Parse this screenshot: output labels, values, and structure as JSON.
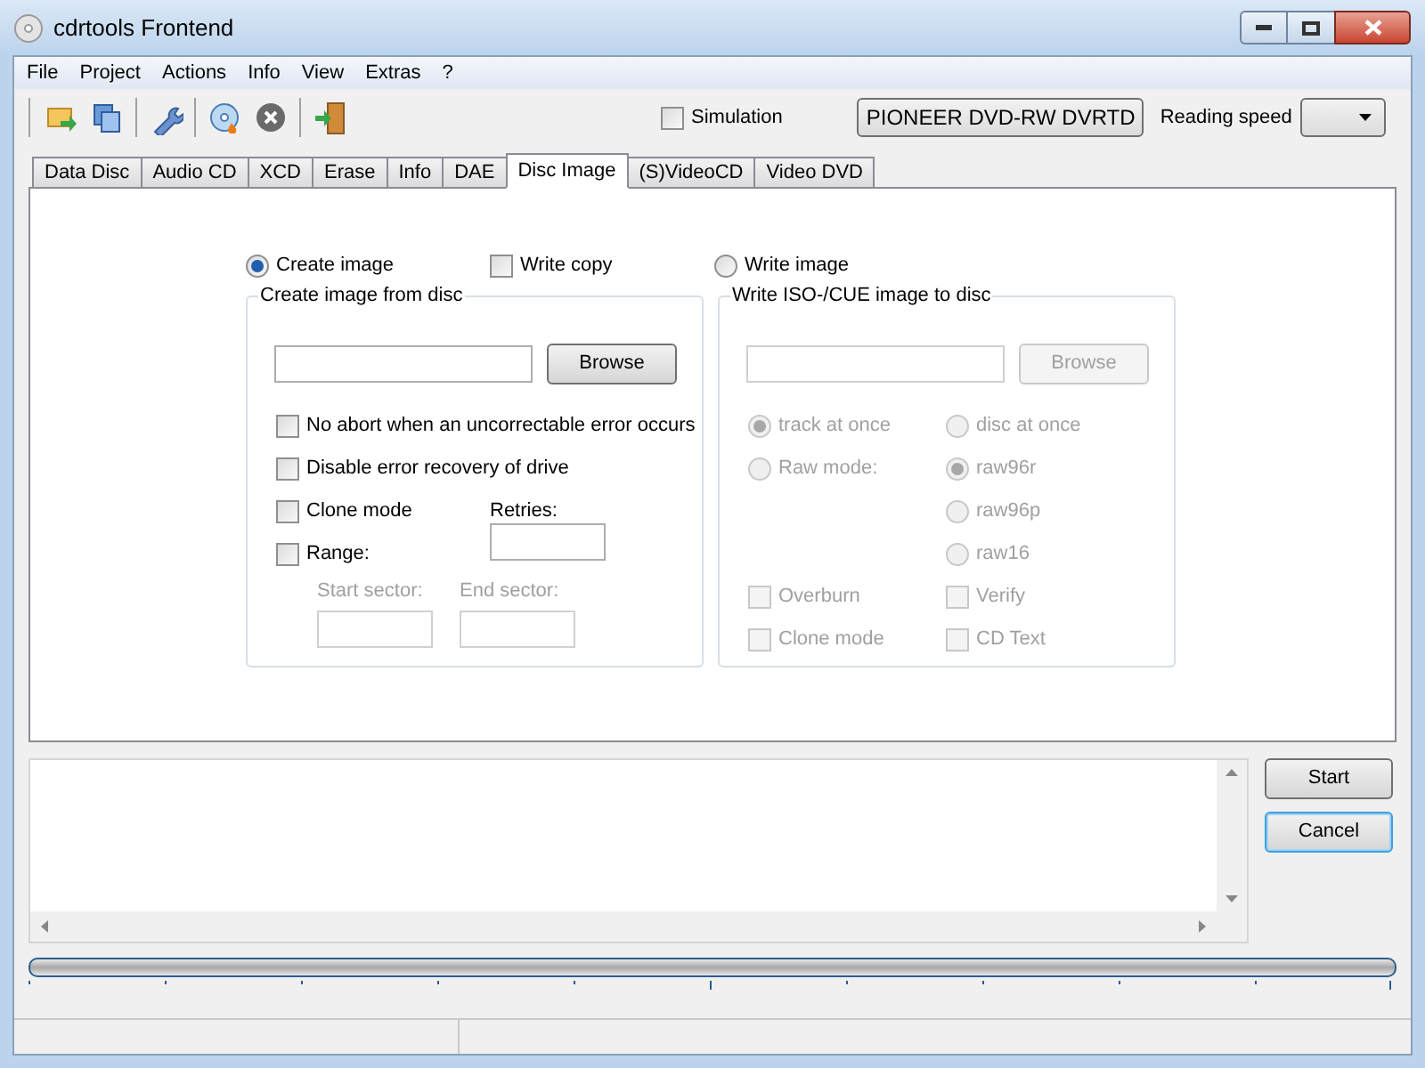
{
  "window": {
    "title": "cdrtools Frontend"
  },
  "menu": [
    "File",
    "Project",
    "Actions",
    "Info",
    "View",
    "Extras",
    "?"
  ],
  "toolbar": {
    "simulation": {
      "label": "Simulation",
      "checked": false
    },
    "drive": {
      "value": "PIONEER DVD-RW DVRTD"
    },
    "reading_speed_label": "Reading speed"
  },
  "tabs": [
    {
      "label": "Data Disc",
      "selected": false
    },
    {
      "label": "Audio CD",
      "selected": false
    },
    {
      "label": "XCD",
      "selected": false
    },
    {
      "label": "Erase",
      "selected": false
    },
    {
      "label": "Info",
      "selected": false
    },
    {
      "label": "DAE",
      "selected": false
    },
    {
      "label": "Disc Image",
      "selected": true
    },
    {
      "label": "(S)VideoCD",
      "selected": false
    },
    {
      "label": "Video DVD",
      "selected": false
    }
  ],
  "mode_options": [
    {
      "kind": "radio",
      "label": "Create image",
      "selected": true
    },
    {
      "kind": "checkbox",
      "label": "Write copy",
      "selected": false
    },
    {
      "kind": "radio",
      "label": "Write image",
      "selected": false
    }
  ],
  "left_group": {
    "title": "Create image from disc",
    "browse_button": {
      "label": "Browse",
      "disabled": false
    },
    "options": [
      {
        "label": "No abort when an uncorrectable error occurs",
        "checked": false,
        "disabled": false
      },
      {
        "label": "Disable error recovery of drive",
        "checked": false,
        "disabled": false
      },
      {
        "label": "Clone mode",
        "checked": false,
        "disabled": false
      },
      {
        "label": "Range:",
        "checked": false,
        "disabled": false
      }
    ],
    "retries_label": "Retries:",
    "start_sector": {
      "label": "Start sector:",
      "disabled": true
    },
    "end_sector": {
      "label": "End sector:",
      "disabled": true
    }
  },
  "right_group": {
    "title": "Write ISO-/CUE image to disc",
    "browse_button": {
      "label": "Browse",
      "disabled": true
    },
    "write_modes": [
      {
        "label": "track at once",
        "selected": true,
        "disabled": true
      },
      {
        "label": "disc at once",
        "selected": false,
        "disabled": true
      },
      {
        "label": "Raw mode:",
        "selected": false,
        "disabled": true
      }
    ],
    "raw_modes": [
      {
        "label": "raw96r",
        "selected": true,
        "disabled": true
      },
      {
        "label": "raw96p",
        "selected": false,
        "disabled": true
      },
      {
        "label": "raw16",
        "selected": false,
        "disabled": true
      }
    ],
    "flags": [
      {
        "label": "Overburn",
        "checked": false,
        "disabled": true
      },
      {
        "label": "Verify",
        "checked": false,
        "disabled": true
      },
      {
        "label": "Clone mode",
        "checked": false,
        "disabled": true
      },
      {
        "label": "CD Text",
        "checked": false,
        "disabled": true
      }
    ]
  },
  "buttons": [
    {
      "label": "Start",
      "focused": false
    },
    {
      "label": "Cancel",
      "focused": true
    }
  ]
}
